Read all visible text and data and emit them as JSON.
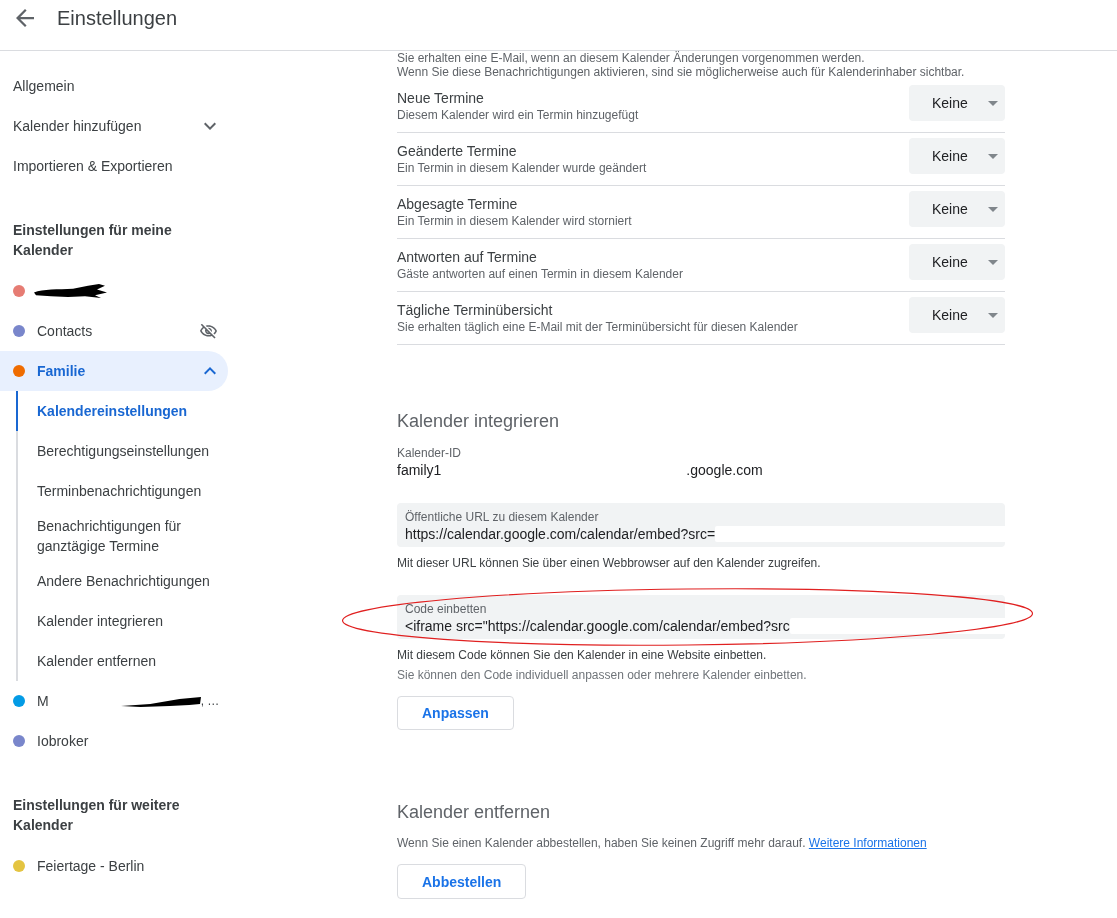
{
  "header": {
    "title": "Einstellungen"
  },
  "sidebar": {
    "items": [
      {
        "label": "Allgemein"
      },
      {
        "label": "Kalender hinzufügen",
        "expanded": false
      },
      {
        "label": "Importieren & Exportieren"
      }
    ],
    "my_calendars": {
      "heading": "Einstellungen für meine Kalender",
      "items": [
        {
          "color": "#e67c73",
          "redacted": true,
          "hidden": false,
          "selected": false
        },
        {
          "label": "Contacts",
          "color": "#7986cb",
          "redacted": false,
          "hidden": true,
          "selected": false
        },
        {
          "label": "Familie",
          "color": "#ef6c00",
          "redacted": false,
          "hidden": false,
          "selected": true,
          "expanded": true,
          "children": [
            {
              "label": "Kalendereinstellungen",
              "selected": true
            },
            {
              "label": "Berechtigungseinstellungen",
              "selected": false
            },
            {
              "label": "Terminbenachrichtigungen",
              "selected": false
            },
            {
              "label": "Benachrichtigungen für ganztägige Termine",
              "selected": false
            },
            {
              "label": "Andere Benachrichtigungen",
              "selected": false
            },
            {
              "label": "Kalender integrieren",
              "selected": false
            },
            {
              "label": "Kalender entfernen",
              "selected": false
            }
          ]
        },
        {
          "label": "M",
          "label_end": ", …",
          "color": "#039be5",
          "redacted": true,
          "hidden": false,
          "selected": false
        },
        {
          "label": "Iobroker",
          "color": "#7986cb",
          "redacted": false,
          "hidden": false,
          "selected": false
        }
      ]
    },
    "other_calendars": {
      "heading": "Einstellungen für weitere Kalender",
      "items": [
        {
          "label": "Feiertage - Berlin",
          "color": "#e4c441",
          "redacted": false,
          "hidden": false,
          "selected": false
        }
      ]
    }
  },
  "notifications": {
    "intro": [
      "Sie erhalten eine E-Mail, wenn an diesem Kalender Änderungen vorgenommen werden.",
      "Wenn Sie diese Benachrichtigungen aktivieren, sind sie möglicherweise auch für Kalenderinhaber sichtbar."
    ],
    "rows": [
      {
        "title": "Neue Termine",
        "description": "Diesem Kalender wird ein Termin hinzugefügt",
        "value": "Keine"
      },
      {
        "title": "Geänderte Termine",
        "description": "Ein Termin in diesem Kalender wurde geändert",
        "value": "Keine"
      },
      {
        "title": "Abgesagte Termine",
        "description": "Ein Termin in diesem Kalender wird storniert",
        "value": "Keine"
      },
      {
        "title": "Antworten auf Termine",
        "description": "Gäste antworten auf einen Termin in diesem Kalender",
        "value": "Keine"
      },
      {
        "title": "Tägliche Terminübersicht",
        "description": "Sie erhalten täglich eine E-Mail mit der Terminübersicht für diesen Kalender",
        "value": "Keine"
      }
    ]
  },
  "integrate": {
    "heading": "Kalender integrieren",
    "calendar_id": {
      "label": "Kalender-ID",
      "value_start": "family1",
      "value_end": ".google.com"
    },
    "fields": [
      {
        "label": "Öffentliche URL zu diesem Kalender",
        "value": "https://calendar.google.com/calendar/embed?src=",
        "redacted": true,
        "circled": false,
        "hints": [
          {
            "kind": "info",
            "text": "Mit dieser URL können Sie über einen Webbrowser auf den Kalender zugreifen."
          }
        ]
      },
      {
        "label": "Code einbetten",
        "value": "<iframe src=\"https://calendar.google.com/calendar/embed?src",
        "redacted": true,
        "circled": true,
        "hints": [
          {
            "kind": "info",
            "text": "Mit diesem Code können Sie den Kalender in eine Website einbetten."
          },
          {
            "kind": "note",
            "text": "Sie können den Code individuell anpassen oder mehrere Kalender einbetten."
          }
        ]
      }
    ],
    "button": "Anpassen"
  },
  "remove": {
    "heading": "Kalender entfernen",
    "description": "Wenn Sie einen Kalender abbestellen, haben Sie keinen Zugriff mehr darauf.",
    "link": "Weitere Informationen",
    "button": "Abbestellen"
  }
}
